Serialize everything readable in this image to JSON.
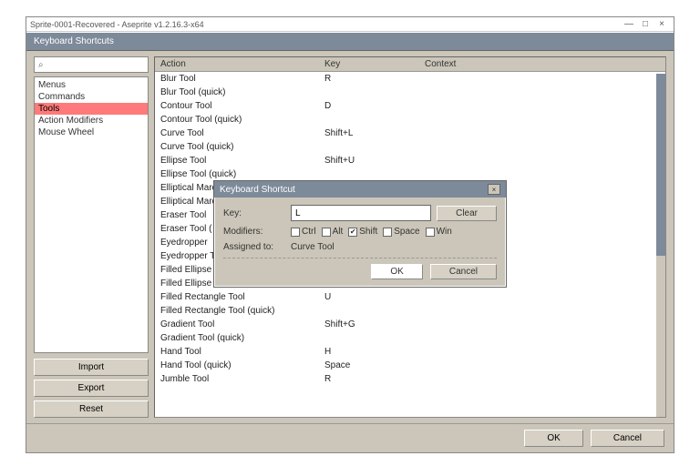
{
  "window": {
    "title": "Sprite-0001-Recovered - Aseprite v1.2.16.3-x64",
    "minimize": "—",
    "maximize": "□",
    "close": "×"
  },
  "dialog": {
    "title": "Keyboard Shortcuts",
    "search_placeholder": "",
    "categories": [
      "Menus",
      "Commands",
      "Tools",
      "Action Modifiers",
      "Mouse Wheel"
    ],
    "selected_category": "Tools",
    "columns": {
      "action": "Action",
      "key": "Key",
      "context": "Context"
    },
    "rows": [
      {
        "action": "Blur Tool",
        "key": "R"
      },
      {
        "action": "Blur Tool (quick)",
        "key": ""
      },
      {
        "action": "Contour Tool",
        "key": "D"
      },
      {
        "action": "Contour Tool (quick)",
        "key": ""
      },
      {
        "action": "Curve Tool",
        "key": "Shift+L"
      },
      {
        "action": "Curve Tool (quick)",
        "key": ""
      },
      {
        "action": "Ellipse Tool",
        "key": "Shift+U"
      },
      {
        "action": "Ellipse Tool (quick)",
        "key": ""
      },
      {
        "action": "Elliptical Marq",
        "key": ""
      },
      {
        "action": "Elliptical Marq",
        "key": ""
      },
      {
        "action": "Eraser Tool",
        "key": ""
      },
      {
        "action": "Eraser Tool (",
        "key": ""
      },
      {
        "action": "Eyedropper",
        "key": ""
      },
      {
        "action": "Eyedropper T",
        "key": ""
      },
      {
        "action": "Filled Ellipse",
        "key": ""
      },
      {
        "action": "Filled Ellipse Tool (quick)",
        "key": ""
      },
      {
        "action": "Filled Rectangle Tool",
        "key": "U"
      },
      {
        "action": "Filled Rectangle Tool (quick)",
        "key": ""
      },
      {
        "action": "Gradient Tool",
        "key": "Shift+G"
      },
      {
        "action": "Gradient Tool (quick)",
        "key": ""
      },
      {
        "action": "Hand Tool",
        "key": "H"
      },
      {
        "action": "Hand Tool (quick)",
        "key": "Space"
      },
      {
        "action": "Jumble Tool",
        "key": "R"
      }
    ],
    "import": "Import",
    "export": "Export",
    "reset": "Reset",
    "ok": "OK",
    "cancel": "Cancel"
  },
  "modal": {
    "title": "Keyboard Shortcut",
    "close": "×",
    "key_label": "Key:",
    "key_value": "L",
    "clear": "Clear",
    "modifiers_label": "Modifiers:",
    "mods": {
      "ctrl": {
        "label": "Ctrl",
        "checked": false
      },
      "alt": {
        "label": "Alt",
        "checked": false
      },
      "shift": {
        "label": "Shift",
        "checked": true
      },
      "space": {
        "label": "Space",
        "checked": false
      },
      "win": {
        "label": "Win",
        "checked": false
      }
    },
    "assigned_label": "Assigned to:",
    "assigned_value": "Curve Tool",
    "ok": "OK",
    "cancel": "Cancel"
  }
}
